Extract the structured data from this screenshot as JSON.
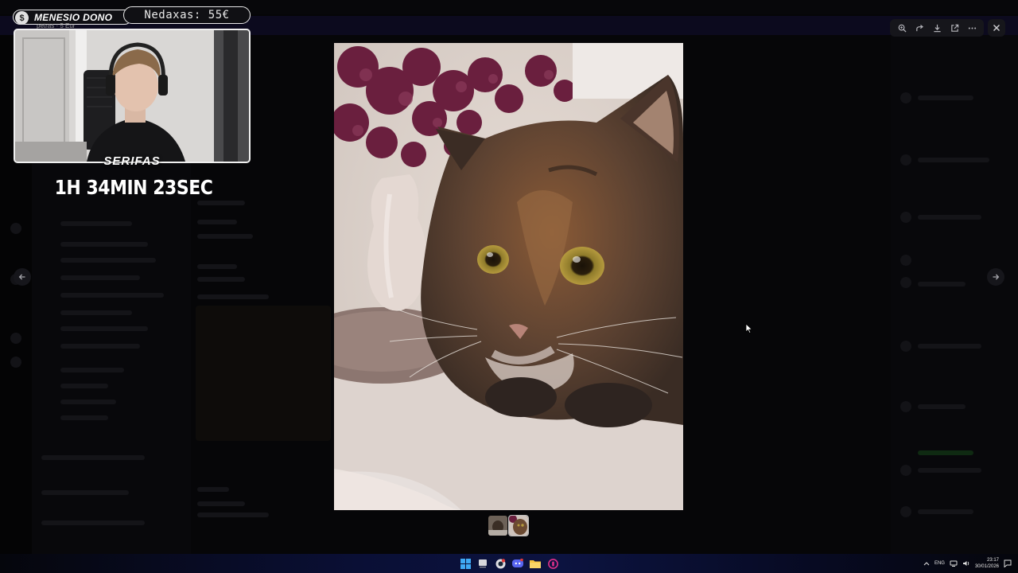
{
  "overlay": {
    "donor_name": "MENESIO DONO",
    "donor_sub": "petras · 5 Eur",
    "donor_coin": "$",
    "amount": "Nedaxas: 55€",
    "streamer_name": "SERIFAS",
    "timer": "1H 34MIN 23SEC"
  },
  "viewer": {
    "toolbar_icons": [
      "zoom-in-icon",
      "share-icon",
      "download-icon",
      "open-external-icon",
      "more-icon"
    ],
    "close_icon": "close-icon",
    "thumbnail_count": 2,
    "active_thumbnail": 2
  },
  "taskbar": {
    "language": "ENG",
    "time": "23:17",
    "date": "30/01/2026"
  },
  "colors": {
    "accent": "#5865f2",
    "taskbar_blue": "#0c1340"
  }
}
